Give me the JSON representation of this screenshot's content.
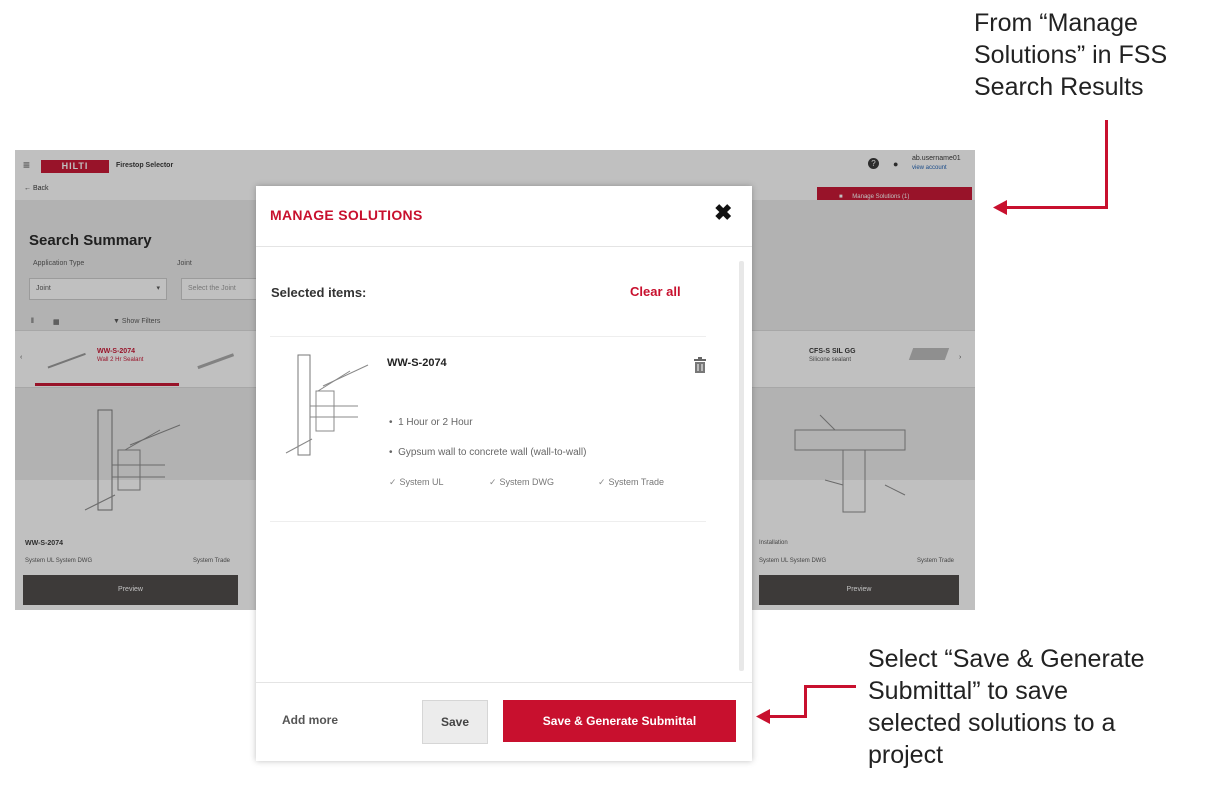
{
  "background_app": {
    "logo": "HILTI",
    "app_title": "Firestop Selector",
    "back_label": "Back",
    "user_name": "ab.username01",
    "user_sub": "view account",
    "manage_solutions_button": "Manage Solutions (1)",
    "page_title": "Search Summary",
    "filter1_label": "Application Type",
    "filter1_value": "Joint",
    "filter2_label": "Joint",
    "filter2_placeholder": "Select the Joint",
    "show_filters": "Show Filters",
    "tile1_title": "WW-S-2074",
    "tile1_sub": "Wall 2 Hr Sealant",
    "tile4_title": "CFS-S SIL GG",
    "tile4_sub": "Silicone sealant",
    "card_left_id": "WW-S-2074",
    "card_left_systems": "System UL   System DWG",
    "card_left_extra": "System Trade",
    "card_left_button": "Preview",
    "card_right_id": "Installation",
    "card_right_systems": "System UL   System DWG",
    "card_right_extra": "System Trade",
    "card_right_button": "Preview"
  },
  "modal": {
    "title": "MANAGE SOLUTIONS",
    "selected_label": "Selected items:",
    "clear_all": "Clear all",
    "item": {
      "name": "WW-S-2074",
      "bullets": [
        "1 Hour or 2 Hour",
        "Gypsum wall to concrete wall (wall-to-wall)"
      ],
      "checks": [
        "System UL",
        "System DWG",
        "System Trade"
      ]
    },
    "add_more": "Add more",
    "save": "Save",
    "save_generate": "Save & Generate Submittal"
  },
  "annotations": {
    "top_note_lines": [
      "From “Manage",
      "Solutions” in FSS",
      "Search Results"
    ],
    "bottom_note_lines": [
      "Select “Save & Generate",
      "Submittal” to save",
      "selected solutions to a",
      "project"
    ]
  },
  "colors": {
    "brand_red": "#c8102e",
    "dark_button": "#4a4645"
  },
  "icons": [
    "menu-icon",
    "help-icon",
    "user-icon",
    "arrow-left-icon",
    "close-icon",
    "trash-icon",
    "check-icon",
    "bag-icon",
    "list-view-icon",
    "grid-view-icon",
    "filter-icon",
    "chevron-left-icon",
    "chevron-right-icon"
  ]
}
